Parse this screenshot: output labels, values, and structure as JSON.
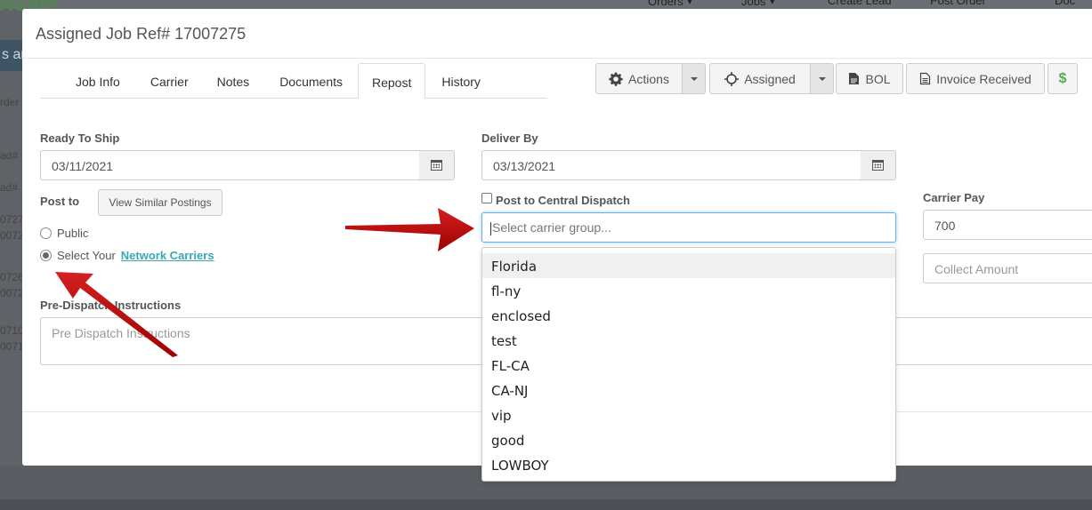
{
  "background": {
    "logo": "RShip",
    "nav": [
      {
        "icon": "orders-icon",
        "label": "Orders"
      },
      {
        "icon": "jobs-icon",
        "label": "Jobs"
      },
      {
        "icon": "create-lead-icon",
        "label": "Create Lead"
      },
      {
        "icon": "post-order-icon",
        "label": "Post Order"
      },
      {
        "icon": "doc-icon",
        "label": "Doc"
      }
    ],
    "side_band": "s ar",
    "side_texts": [
      "rder",
      "ad#",
      "ad#",
      "0727",
      "0072",
      "0726",
      "0072",
      "0710",
      "0071"
    ]
  },
  "modal": {
    "title": "Assigned Job Ref# 17007275"
  },
  "tabs": [
    {
      "label": "Job Info",
      "active": false
    },
    {
      "label": "Carrier",
      "active": false
    },
    {
      "label": "Notes",
      "active": false
    },
    {
      "label": "Documents",
      "active": false
    },
    {
      "label": "Repost",
      "active": true
    },
    {
      "label": "History",
      "active": false
    }
  ],
  "toolbar": {
    "actions_label": "Actions",
    "assigned_label": "Assigned",
    "bol_label": "BOL",
    "invoice_label": "Invoice Received",
    "dollar_label": "$",
    "dollar_color": "#4cae4c"
  },
  "form": {
    "ready_to_ship_label": "Ready To Ship",
    "ready_to_ship_value": "03/11/2021",
    "deliver_by_label": "Deliver By",
    "deliver_by_value": "03/13/2021",
    "post_to_label": "Post to",
    "view_similar_label": "View Similar Postings",
    "radio_public": "Public",
    "radio_network_prefix": "Select Your",
    "radio_network_link": "Network Carriers",
    "central_dispatch_label": "Post to Central Dispatch",
    "carrier_group_placeholder": "Select carrier group...",
    "carrier_pay_label": "Carrier Pay",
    "carrier_pay_value": "700",
    "collect_amount_placeholder": "Collect Amount",
    "pre_dispatch_label": "Pre-Dispatch Instructions",
    "pre_dispatch_placeholder": "Pre Dispatch Instructions"
  },
  "carrier_groups": [
    "Florida",
    "fl-ny",
    "enclosed",
    "test",
    "FL-CA",
    "CA-NJ",
    "vip",
    "good",
    "LOWBOY"
  ],
  "colors": {
    "arrow": "#c00000",
    "link": "#3aa7b5",
    "focus": "#66afe9"
  }
}
